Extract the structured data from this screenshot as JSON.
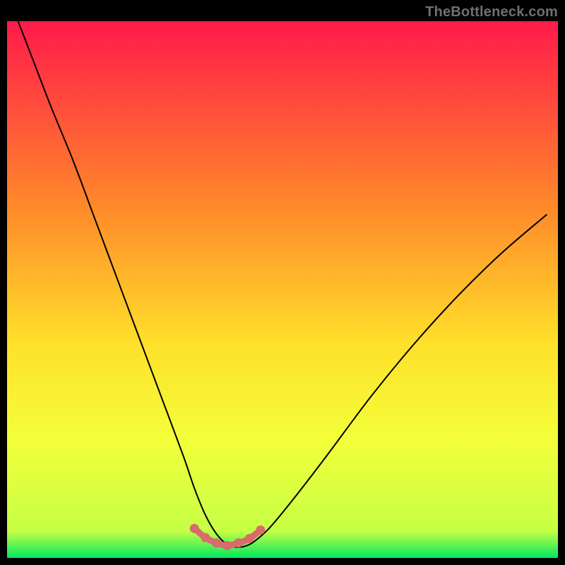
{
  "watermark": "TheBottleneck.com",
  "colors": {
    "black": "#000000",
    "curve": "#000000",
    "dots": "#d86b6b",
    "grad_top": "#ff1a4a",
    "grad_mid1": "#ff8a2a",
    "grad_mid2": "#ffe02a",
    "grad_mid3": "#f3ff3a",
    "grad_bottom": "#00e860",
    "watermark_text": "#707070"
  },
  "chart_data": {
    "type": "line",
    "title": "",
    "xlabel": "",
    "ylabel": "",
    "xlim": [
      0,
      100
    ],
    "ylim": [
      0,
      100
    ],
    "series": [
      {
        "name": "bottleneck-curve",
        "x": [
          2,
          5,
          8,
          12,
          16,
          20,
          24,
          28,
          32,
          34,
          36,
          38,
          40,
          42,
          44,
          46,
          48,
          52,
          58,
          66,
          74,
          82,
          90,
          98
        ],
        "y": [
          100,
          92,
          84,
          74,
          63,
          52,
          41,
          30,
          19,
          13,
          8,
          4.5,
          2.5,
          2,
          2.5,
          4,
          6,
          11,
          19,
          30,
          40,
          49,
          57,
          64
        ]
      },
      {
        "name": "optimal-zone-dots",
        "x": [
          34,
          36,
          38,
          40,
          42,
          44,
          46
        ],
        "y": [
          5.5,
          3.8,
          2.8,
          2.3,
          2.8,
          3.6,
          5.2
        ]
      }
    ],
    "gradient_stops": [
      {
        "offset": 0.0,
        "color": "#ff1a4a"
      },
      {
        "offset": 0.35,
        "color": "#ff8a2a"
      },
      {
        "offset": 0.6,
        "color": "#ffe02a"
      },
      {
        "offset": 0.78,
        "color": "#f3ff3a"
      },
      {
        "offset": 0.95,
        "color": "#c6ff45"
      },
      {
        "offset": 1.0,
        "color": "#00e860"
      }
    ]
  }
}
